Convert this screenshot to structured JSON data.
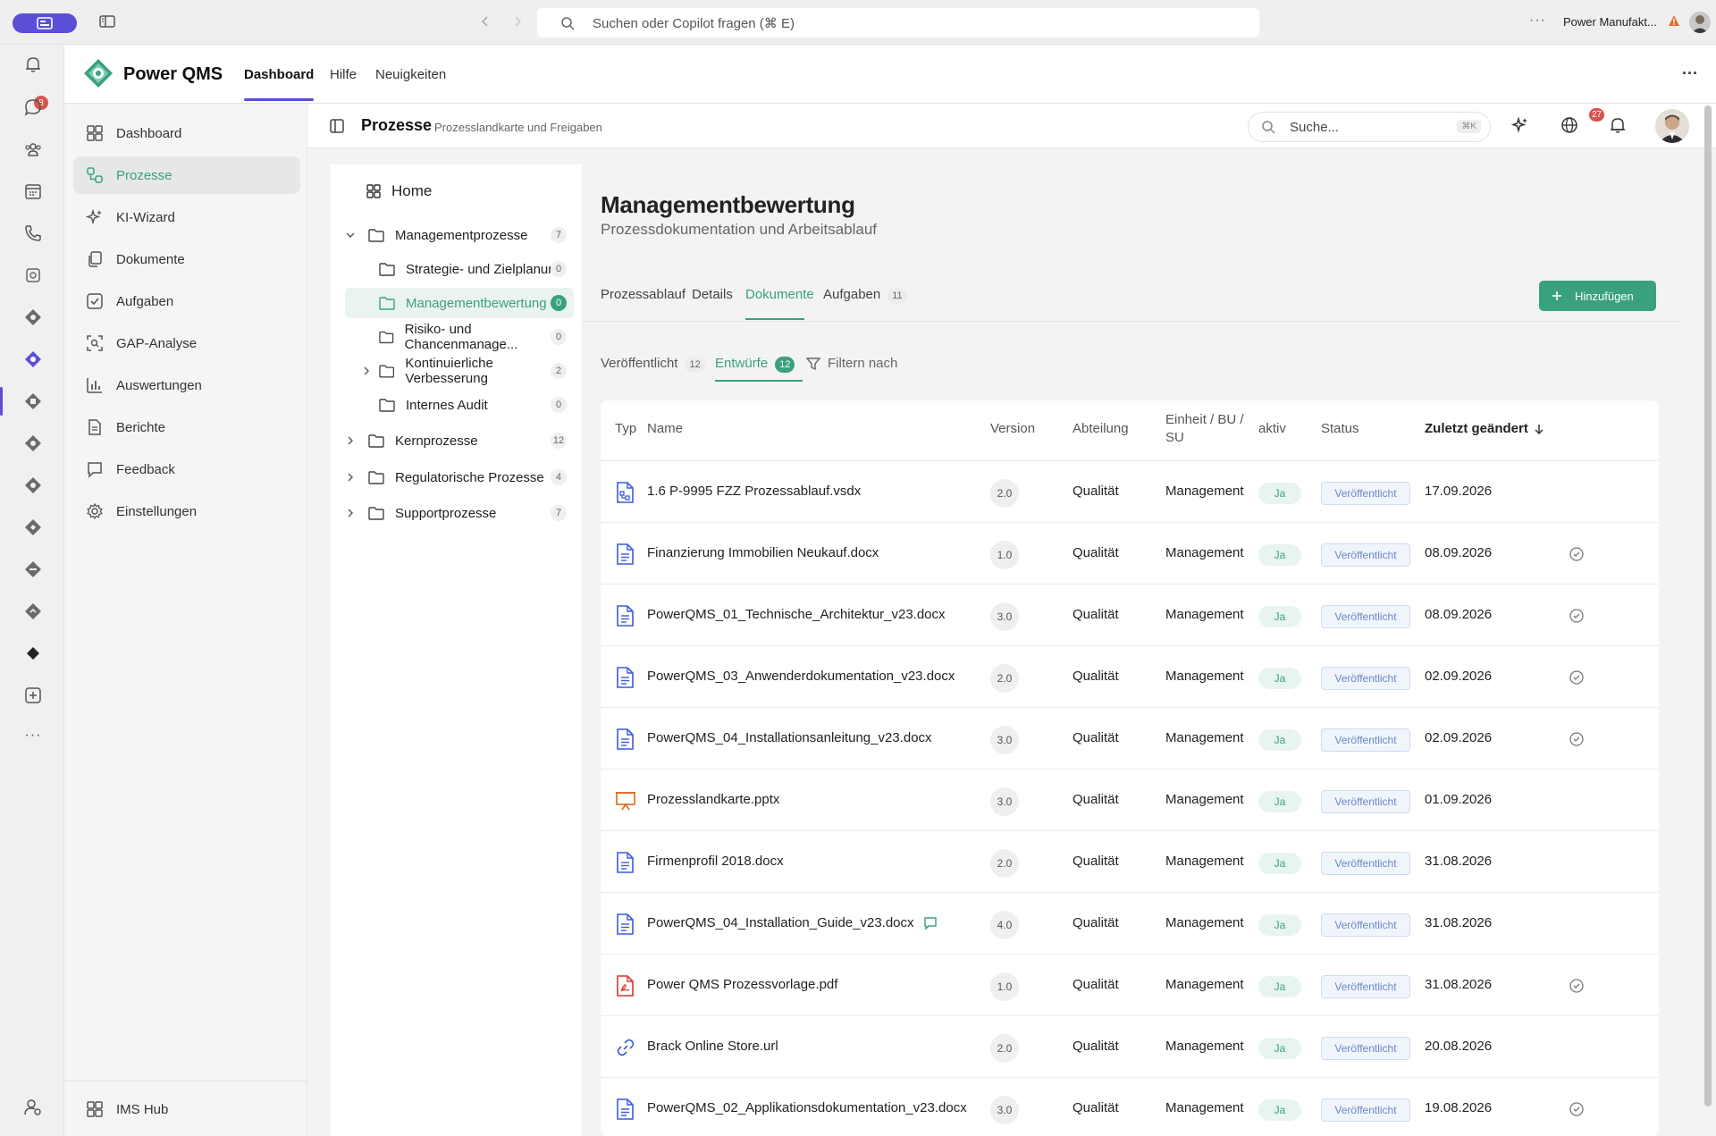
{
  "window": {
    "search_placeholder": "Suchen oder Copilot fragen (⌘ E)",
    "tenant_name": "Power Manufakt...",
    "more": "···"
  },
  "rail": {
    "notification_count": "8",
    "more": "···"
  },
  "app": {
    "brand": "Power QMS",
    "tabs": [
      {
        "label": "Dashboard"
      },
      {
        "label": "Hilfe"
      },
      {
        "label": "Neuigkeiten"
      }
    ],
    "more": "···"
  },
  "nav": {
    "items": [
      {
        "label": "Dashboard",
        "icon": "grid-icon"
      },
      {
        "label": "Prozesse",
        "icon": "process-icon"
      },
      {
        "label": "KI-Wizard",
        "icon": "sparkle-icon"
      },
      {
        "label": "Dokumente",
        "icon": "documents-icon"
      },
      {
        "label": "Aufgaben",
        "icon": "task-check-icon"
      },
      {
        "label": "GAP-Analyse",
        "icon": "scan-icon"
      },
      {
        "label": "Auswertungen",
        "icon": "bar-chart-icon"
      },
      {
        "label": "Berichte",
        "icon": "report-icon"
      },
      {
        "label": "Feedback",
        "icon": "comment-icon"
      },
      {
        "label": "Einstellungen",
        "icon": "gear-icon"
      }
    ],
    "footer": {
      "label": "IMS Hub"
    }
  },
  "header": {
    "title": "Prozesse",
    "subtitle": "Prozesslandkarte und Freigaben",
    "search_placeholder": "Suche...",
    "search_kbd": "⌘K",
    "notification_count": "27"
  },
  "tree": {
    "home": "Home",
    "items": [
      {
        "label": "Managementprozesse",
        "count": "7",
        "expanded": true
      },
      {
        "label": "Strategie- und Zielplanung",
        "count": "0"
      },
      {
        "label": "Managementbewertung",
        "count": "0",
        "selected": true
      },
      {
        "label": "Risiko- und Chancenmanage...",
        "count": "0"
      },
      {
        "label": "Kontinuierliche Verbesserung",
        "count": "2"
      },
      {
        "label": "Internes Audit",
        "count": "0"
      },
      {
        "label": "Kernprozesse",
        "count": "12"
      },
      {
        "label": "Regulatorische Prozesse",
        "count": "4"
      },
      {
        "label": "Supportprozesse",
        "count": "7"
      }
    ]
  },
  "content": {
    "title": "Managementbewertung",
    "subtitle": "Prozessdokumentation und Arbeitsablauf",
    "tabs": [
      {
        "label": "Prozessablauf"
      },
      {
        "label": "Details"
      },
      {
        "label": "Dokumente",
        "active": true
      },
      {
        "label": "Aufgaben",
        "count": "11"
      }
    ],
    "add_button": "Hinzufügen",
    "subtabs": [
      {
        "label": "Veröffentlicht",
        "count": "12"
      },
      {
        "label": "Entwürfe",
        "count": "12",
        "active": true
      }
    ],
    "filter_label": "Filtern nach",
    "columns": {
      "type": "Typ",
      "name": "Name",
      "version": "Version",
      "department": "Abteilung",
      "unit": "Einheit / BU / SU",
      "active": "aktiv",
      "status": "Status",
      "modified": "Zuletzt geändert"
    },
    "rows": [
      {
        "name": "1.6 P-9995 FZZ Prozessablauf.vsdx",
        "type": "diagram-file-icon",
        "version": "2.0",
        "department": "Qualität",
        "unit": "Management",
        "active": "Ja",
        "status": "Veröffentlicht",
        "modified": "17.09.2026",
        "check": false,
        "comment": false
      },
      {
        "name": "Finanzierung Immobilien Neukauf.docx",
        "type": "word-file-icon",
        "version": "1.0",
        "department": "Qualität",
        "unit": "Management",
        "active": "Ja",
        "status": "Veröffentlicht",
        "modified": "08.09.2026",
        "check": true,
        "comment": false
      },
      {
        "name": "PowerQMS_01_Technische_Architektur_v23.docx",
        "type": "word-file-icon",
        "version": "3.0",
        "department": "Qualität",
        "unit": "Management",
        "active": "Ja",
        "status": "Veröffentlicht",
        "modified": "08.09.2026",
        "check": true,
        "comment": false
      },
      {
        "name": "PowerQMS_03_Anwenderdokumentation_v23.docx",
        "type": "word-file-icon",
        "version": "2.0",
        "department": "Qualität",
        "unit": "Management",
        "active": "Ja",
        "status": "Veröffentlicht",
        "modified": "02.09.2026",
        "check": true,
        "comment": false
      },
      {
        "name": "PowerQMS_04_Installationsanleitung_v23.docx",
        "type": "word-file-icon",
        "version": "3.0",
        "department": "Qualität",
        "unit": "Management",
        "active": "Ja",
        "status": "Veröffentlicht",
        "modified": "02.09.2026",
        "check": true,
        "comment": false
      },
      {
        "name": "Prozesslandkarte.pptx",
        "type": "presentation-file-icon",
        "version": "3.0",
        "department": "Qualität",
        "unit": "Management",
        "active": "Ja",
        "status": "Veröffentlicht",
        "modified": "01.09.2026",
        "check": false,
        "comment": false
      },
      {
        "name": "Firmenprofil 2018.docx",
        "type": "word-file-icon",
        "version": "2.0",
        "department": "Qualität",
        "unit": "Management",
        "active": "Ja",
        "status": "Veröffentlicht",
        "modified": "31.08.2026",
        "check": false,
        "comment": false
      },
      {
        "name": "PowerQMS_04_Installation_Guide_v23.docx",
        "type": "word-file-icon",
        "version": "4.0",
        "department": "Qualität",
        "unit": "Management",
        "active": "Ja",
        "status": "Veröffentlicht",
        "modified": "31.08.2026",
        "check": false,
        "comment": true
      },
      {
        "name": "Power QMS Prozessvorlage.pdf",
        "type": "pdf-file-icon",
        "version": "1.0",
        "department": "Qualität",
        "unit": "Management",
        "active": "Ja",
        "status": "Veröffentlicht",
        "modified": "31.08.2026",
        "check": true,
        "comment": false
      },
      {
        "name": "Brack Online Store.url",
        "type": "link-icon",
        "version": "2.0",
        "department": "Qualität",
        "unit": "Management",
        "active": "Ja",
        "status": "Veröffentlicht",
        "modified": "20.08.2026",
        "check": false,
        "comment": false
      },
      {
        "name": "PowerQMS_02_Applikationsdokumentation_v23.docx",
        "type": "word-file-icon",
        "version": "3.0",
        "department": "Qualität",
        "unit": "Management",
        "active": "Ja",
        "status": "Veröffentlicht",
        "modified": "19.08.2026",
        "check": true,
        "comment": false
      }
    ]
  },
  "colors": {
    "accent_green": "#3aa17e",
    "brand_purple": "#5b4fd8",
    "status_blue": "#6a88c4",
    "badge_red": "#d9534f"
  }
}
